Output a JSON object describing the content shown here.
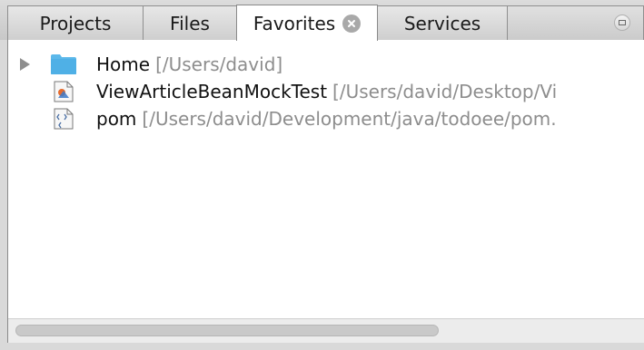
{
  "tabs": [
    {
      "label": "Projects",
      "active": false
    },
    {
      "label": "Files",
      "active": false
    },
    {
      "label": "Favorites",
      "active": true
    },
    {
      "label": "Services",
      "active": false
    }
  ],
  "tree": [
    {
      "name": "Home",
      "path": "[/Users/david]",
      "icon": "folder-icon",
      "expandable": true
    },
    {
      "name": "ViewArticleBeanMockTest",
      "path": "[/Users/david/Desktop/Vi",
      "icon": "java-test-file-icon",
      "expandable": false
    },
    {
      "name": "pom",
      "path": "[/Users/david/Development/java/todoee/pom.",
      "icon": "xml-file-icon",
      "expandable": false
    }
  ],
  "colors": {
    "folder": "#5bb8ea",
    "path_text": "#8d8d8d",
    "active_tab": "#ffffff"
  }
}
